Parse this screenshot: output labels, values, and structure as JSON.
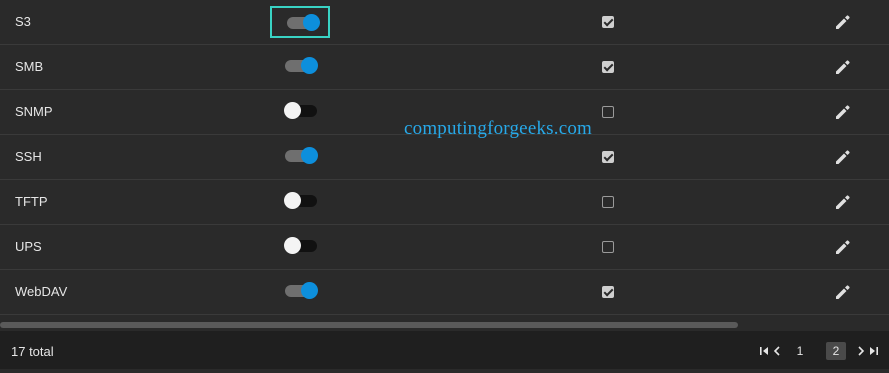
{
  "services": [
    {
      "name": "S3",
      "enabled": true,
      "autostart": true,
      "focused": true
    },
    {
      "name": "SMB",
      "enabled": true,
      "autostart": true,
      "focused": false
    },
    {
      "name": "SNMP",
      "enabled": false,
      "autostart": false,
      "focused": false
    },
    {
      "name": "SSH",
      "enabled": true,
      "autostart": true,
      "focused": false
    },
    {
      "name": "TFTP",
      "enabled": false,
      "autostart": false,
      "focused": false
    },
    {
      "name": "UPS",
      "enabled": false,
      "autostart": false,
      "focused": false
    },
    {
      "name": "WebDAV",
      "enabled": true,
      "autostart": true,
      "focused": false
    }
  ],
  "footer": {
    "total": "17 total",
    "pages": [
      "1",
      "2"
    ],
    "current_page": "2"
  },
  "watermark": "computingforgeeks.com",
  "colors": {
    "accent": "#0d8fdc",
    "focus": "#39d3c4",
    "watermark": "#27a9e9"
  },
  "icons": {
    "edit": "pencil-icon",
    "first_page": "first-page-icon",
    "prev_page": "chevron-left-icon",
    "next_page": "chevron-right-icon",
    "last_page": "last-page-icon"
  }
}
